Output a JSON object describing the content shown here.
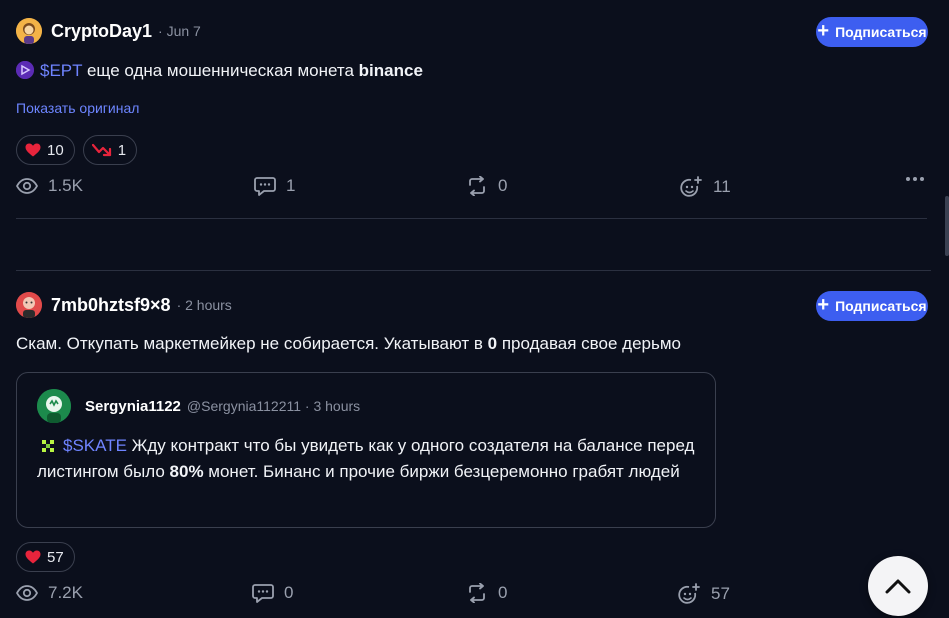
{
  "posts": [
    {
      "username": "CryptoDay1",
      "time": "· Jun 7",
      "follow_label": "Подписаться",
      "text": {
        "coin": "$EPT",
        "rest1": " еще одна мошенническая монета ",
        "bold": "binance"
      },
      "show_original": "Показать оригинал",
      "reactions": [
        {
          "icon": "heart-icon",
          "count": "10"
        },
        {
          "icon": "trend-down-icon",
          "count": "1"
        }
      ],
      "stats": {
        "views": "1.5K",
        "comments": "1",
        "reposts": "0",
        "likes": "11"
      }
    },
    {
      "username": "7mb0hztsf9×8",
      "time": "· 2 hours",
      "follow_label": "Подписаться",
      "text": {
        "part1": "Скам. Откупать маркетмейкер не собирается. Укатывают в ",
        "bold": "0",
        "part2": " продавая свое дерьмо"
      },
      "quote": {
        "username": "Sergynia1122",
        "handle": "@Sergynia112211 · 3 hours",
        "coin": "$SKATE",
        "part1": " Жду контракт что бы увидеть как у одного создателя на балансе перед листингом было ",
        "bold": "80%",
        "part2": " монет. Бинанс и прочие биржи безцеремонно грабят людей"
      },
      "reactions": [
        {
          "icon": "heart-icon",
          "count": "57"
        }
      ],
      "stats": {
        "views": "7.2K",
        "comments": "0",
        "reposts": "0",
        "likes": "57"
      }
    }
  ],
  "colors": {
    "background": "#0b0f1c",
    "accent": "#3d5ef0",
    "coin_link": "#6f84ff",
    "muted": "#8b91a1"
  }
}
